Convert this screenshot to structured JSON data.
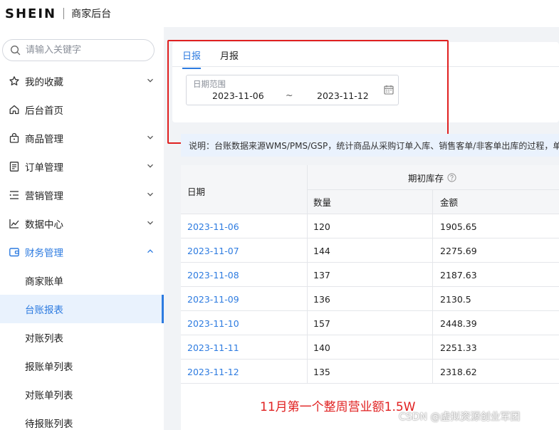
{
  "header": {
    "logo": "SHEIN",
    "subtitle": "商家后台"
  },
  "sidebar": {
    "search_placeholder": "请输入关键字",
    "items": [
      {
        "label": "我的收藏",
        "icon": "star-icon",
        "expandable": true
      },
      {
        "label": "后台首页",
        "icon": "home-icon",
        "expandable": false
      },
      {
        "label": "商品管理",
        "icon": "bag-icon",
        "expandable": true
      },
      {
        "label": "订单管理",
        "icon": "order-icon",
        "expandable": true
      },
      {
        "label": "营销管理",
        "icon": "marketing-icon",
        "expandable": true
      },
      {
        "label": "数据中心",
        "icon": "chart-icon",
        "expandable": true
      },
      {
        "label": "财务管理",
        "icon": "wallet-icon",
        "expandable": true,
        "expanded": true
      }
    ],
    "sub_items": [
      {
        "label": "商家账单"
      },
      {
        "label": "台账报表",
        "selected": true
      },
      {
        "label": "对账列表"
      },
      {
        "label": "报账单列表"
      },
      {
        "label": "对账单列表"
      },
      {
        "label": "待报账列表"
      }
    ]
  },
  "main": {
    "tabs": [
      {
        "label": "日报",
        "active": true
      },
      {
        "label": "月报"
      }
    ],
    "date_range": {
      "label": "日期范围",
      "start": "2023-11-06",
      "separator": "~",
      "end": "2023-11-12"
    },
    "note": "说明：台账数据来源WMS/PMS/GSP，统计商品从采购订单入库、销售客单/非客单出库的过程，单"
  },
  "table": {
    "header_date": "日期",
    "header_group": "期初库存",
    "header_qty": "数量",
    "header_amt": "金额",
    "rows": [
      {
        "date": "2023-11-06",
        "qty": "120",
        "amount": "1905.65"
      },
      {
        "date": "2023-11-07",
        "qty": "144",
        "amount": "2275.69"
      },
      {
        "date": "2023-11-08",
        "qty": "137",
        "amount": "2187.63"
      },
      {
        "date": "2023-11-09",
        "qty": "136",
        "amount": "2130.5"
      },
      {
        "date": "2023-11-10",
        "qty": "157",
        "amount": "2448.39"
      },
      {
        "date": "2023-11-11",
        "qty": "140",
        "amount": "2251.33"
      },
      {
        "date": "2023-11-12",
        "qty": "135",
        "amount": "2318.62"
      }
    ]
  },
  "annotation": "11月第一个整周营业额1.5W",
  "watermark": "CSDN @虚拟资源创业军团",
  "colors": {
    "accent": "#2d7be0",
    "annotation": "#e02020"
  }
}
